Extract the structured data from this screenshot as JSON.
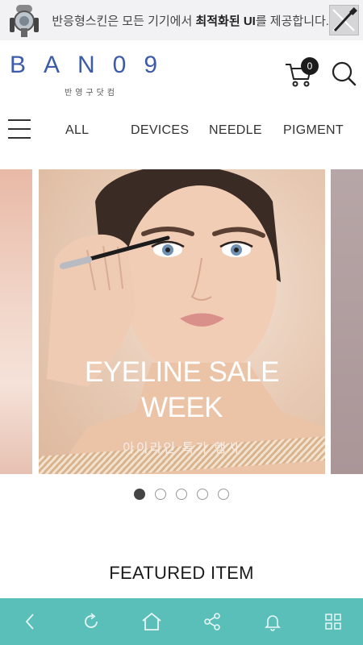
{
  "promo": {
    "text_before": "반응형스킨은 모든 기기에서 ",
    "text_bold": "최적화된 UI",
    "text_after": "를 제공합니다.",
    "icon": "tattoo-machine-icon",
    "close_icon": "close-icon"
  },
  "header": {
    "logo": "BAN09",
    "logo_sub": "반영구닷컴",
    "cart_count": "0",
    "cart_icon": "cart-icon",
    "search_icon": "search-icon"
  },
  "nav": {
    "menu_icon": "hamburger-menu-icon",
    "categories": [
      "ALL",
      "DEVICES",
      "NEEDLE",
      "PIGMENT"
    ]
  },
  "slider": {
    "title_line1": "EYELINE SALE",
    "title_line2": "WEEK",
    "subtitle": "아이라인 특가 행사",
    "slide_count": 5,
    "active_index": 0
  },
  "featured": {
    "heading": "FEATURED ITEM"
  },
  "bottom_bar": {
    "color": "#5bbfb9",
    "icons": [
      "back-icon",
      "refresh-icon",
      "home-icon",
      "share-icon",
      "bell-icon",
      "grid-icon"
    ]
  },
  "colors": {
    "logo": "#3d5ba9",
    "bottom_bar": "#5bbfb9"
  }
}
